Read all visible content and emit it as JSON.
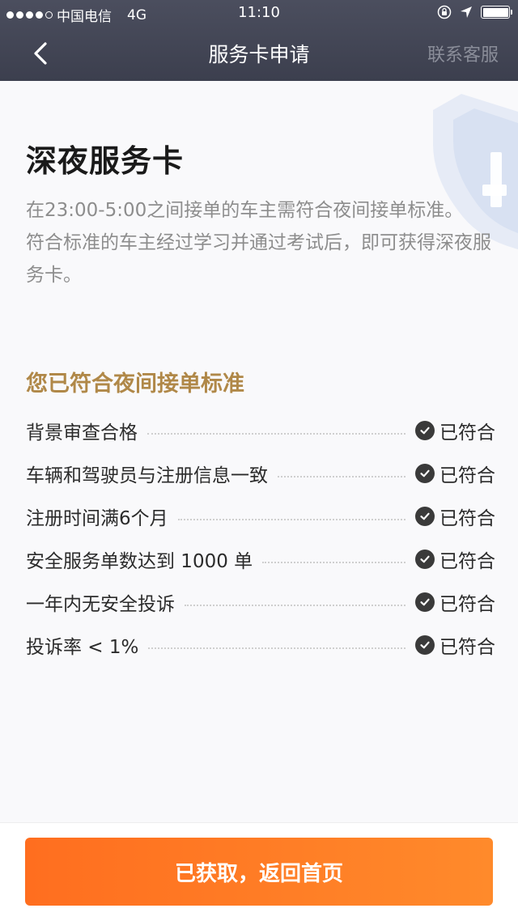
{
  "status_bar": {
    "carrier": "中国电信",
    "network": "4G",
    "time": "11:10"
  },
  "nav": {
    "title": "服务卡申请",
    "support_label": "联系客服"
  },
  "card": {
    "title": "深夜服务卡",
    "description_lines": [
      "在23:00-5:00之间接单的车主需符合夜间接单标准。",
      "符合标准的车主经过学习并通过考试后，即可获得深夜服务卡。"
    ]
  },
  "criteria": {
    "section_title": "您已符合夜间接单标准",
    "items": [
      {
        "label": "背景审查合格",
        "status": "已符合"
      },
      {
        "label": "车辆和驾驶员与注册信息一致",
        "status": "已符合"
      },
      {
        "label": "注册时间满6个月",
        "status": "已符合"
      },
      {
        "label": "安全服务单数达到 1000 单",
        "status": "已符合"
      },
      {
        "label": "一年内无安全投诉",
        "status": "已符合"
      },
      {
        "label": "投诉率 < 1%",
        "status": "已符合"
      }
    ]
  },
  "action": {
    "button_label": "已获取，返回首页"
  },
  "colors": {
    "nav_background": "#41444f",
    "accent_gold": "#b08848",
    "button_orange": "#ff7a25"
  }
}
